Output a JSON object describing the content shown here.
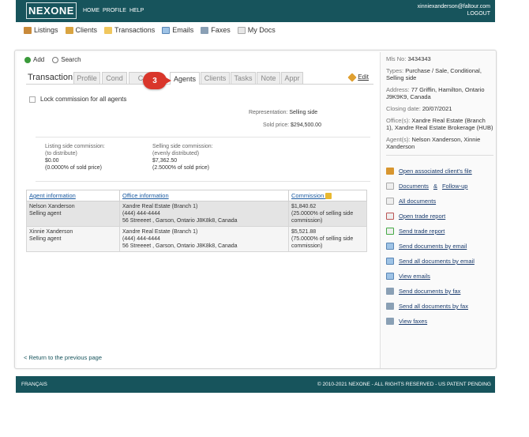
{
  "header": {
    "logo": "NEXONE",
    "nav": [
      "HOME",
      "PROFILE",
      "HELP"
    ],
    "user_email": "xinniexanderson@faltour.com",
    "logout": "LOGOUT"
  },
  "subnav": [
    {
      "label": "Listings",
      "icon": "house-icon"
    },
    {
      "label": "Clients",
      "icon": "clients-icon"
    },
    {
      "label": "Transactions",
      "icon": "folder-icon"
    },
    {
      "label": "Emails",
      "icon": "envelope-icon"
    },
    {
      "label": "Faxes",
      "icon": "printer-icon"
    },
    {
      "label": "My Docs",
      "icon": "documents-icon"
    }
  ],
  "tools": {
    "add": "Add",
    "search": "Search"
  },
  "tabs": {
    "title": "Transaction",
    "items": [
      "Profile",
      "Cond",
      "C",
      "Agents",
      "Clients",
      "Tasks",
      "Note",
      "Appr"
    ],
    "active": "Agents",
    "edit": "Edit"
  },
  "step_marker": "3",
  "lock_label": "Lock commission for all agents",
  "representation": {
    "label": "Representation:",
    "value": "Selling side"
  },
  "sold_price": {
    "label": "Sold price:",
    "value": "$294,500.00"
  },
  "listing_commission": {
    "label": "Listing side commission:",
    "note": "(to distribute)",
    "amount": "$0.00",
    "percent": "(0.0000% of sold price)"
  },
  "selling_commission": {
    "label": "Selling side commission:",
    "note": "(evenly distributed)",
    "amount": "$7,362.50",
    "percent": "(2.5000% of sold price)"
  },
  "agents_table": {
    "headers": [
      "Agent information",
      "Office information",
      "Commission"
    ],
    "rows": [
      {
        "name": "Nelson Xanderson",
        "role": "Selling agent",
        "office": "Xandre Real Estate (Branch 1)",
        "phone": "(444) 444-4444",
        "address": "56 Streeeet , Garson, Ontario J8K8k8, Canada",
        "commission": "$1,840.62",
        "comm_line1": "(25.0000% of selling side",
        "comm_line2": "commission)"
      },
      {
        "name": "Xinnie Xanderson",
        "role": "Selling agent",
        "office": "Xandre Real Estate (Branch 1)",
        "phone": "(444) 444-4444",
        "address": "56 Streeeet , Garson, Ontario J8K8k8, Canada",
        "commission": "$5,521.88",
        "comm_line1": "(75.0000% of selling side",
        "comm_line2": "commission)"
      }
    ]
  },
  "back_link": "< Return to the previous page",
  "sidebar": {
    "mls_label": "Mls No:",
    "mls_value": "3434343",
    "types_label": "Types:",
    "types_value": "Purchase / Sale, Conditional, Selling side",
    "address_label": "Address:",
    "address_value": "77 Griffin, Hamilton, Ontario J9K9K9, Canada",
    "closing_label": "Closing date:",
    "closing_value": "20/07/2021",
    "offices_label": "Office(s):",
    "offices_value": "Xandre Real Estate (Branch 1), Xandre Real Estate Brokerage (HUB)",
    "agents_label": "Agent(s):",
    "agents_value": "Nelson Xanderson, Xinnie Xanderson",
    "links": [
      "Open associated client's file",
      "Documents",
      "Follow-up",
      "All documents",
      "Open trade report",
      "Send trade report",
      "Send documents by email",
      "Send all documents by email",
      "View emails",
      "Send documents by fax",
      "Send all documents by fax",
      "View faxes"
    ],
    "amp": "&"
  },
  "footer": {
    "lang": "FRANÇAIS",
    "copyright": "© 2010-2021 NEXONE - ALL RIGHTS RESERVED - US PATENT PENDING"
  },
  "colors": {
    "brand": "#17545c",
    "marker": "#d9362b",
    "link": "#1a3c6e"
  }
}
